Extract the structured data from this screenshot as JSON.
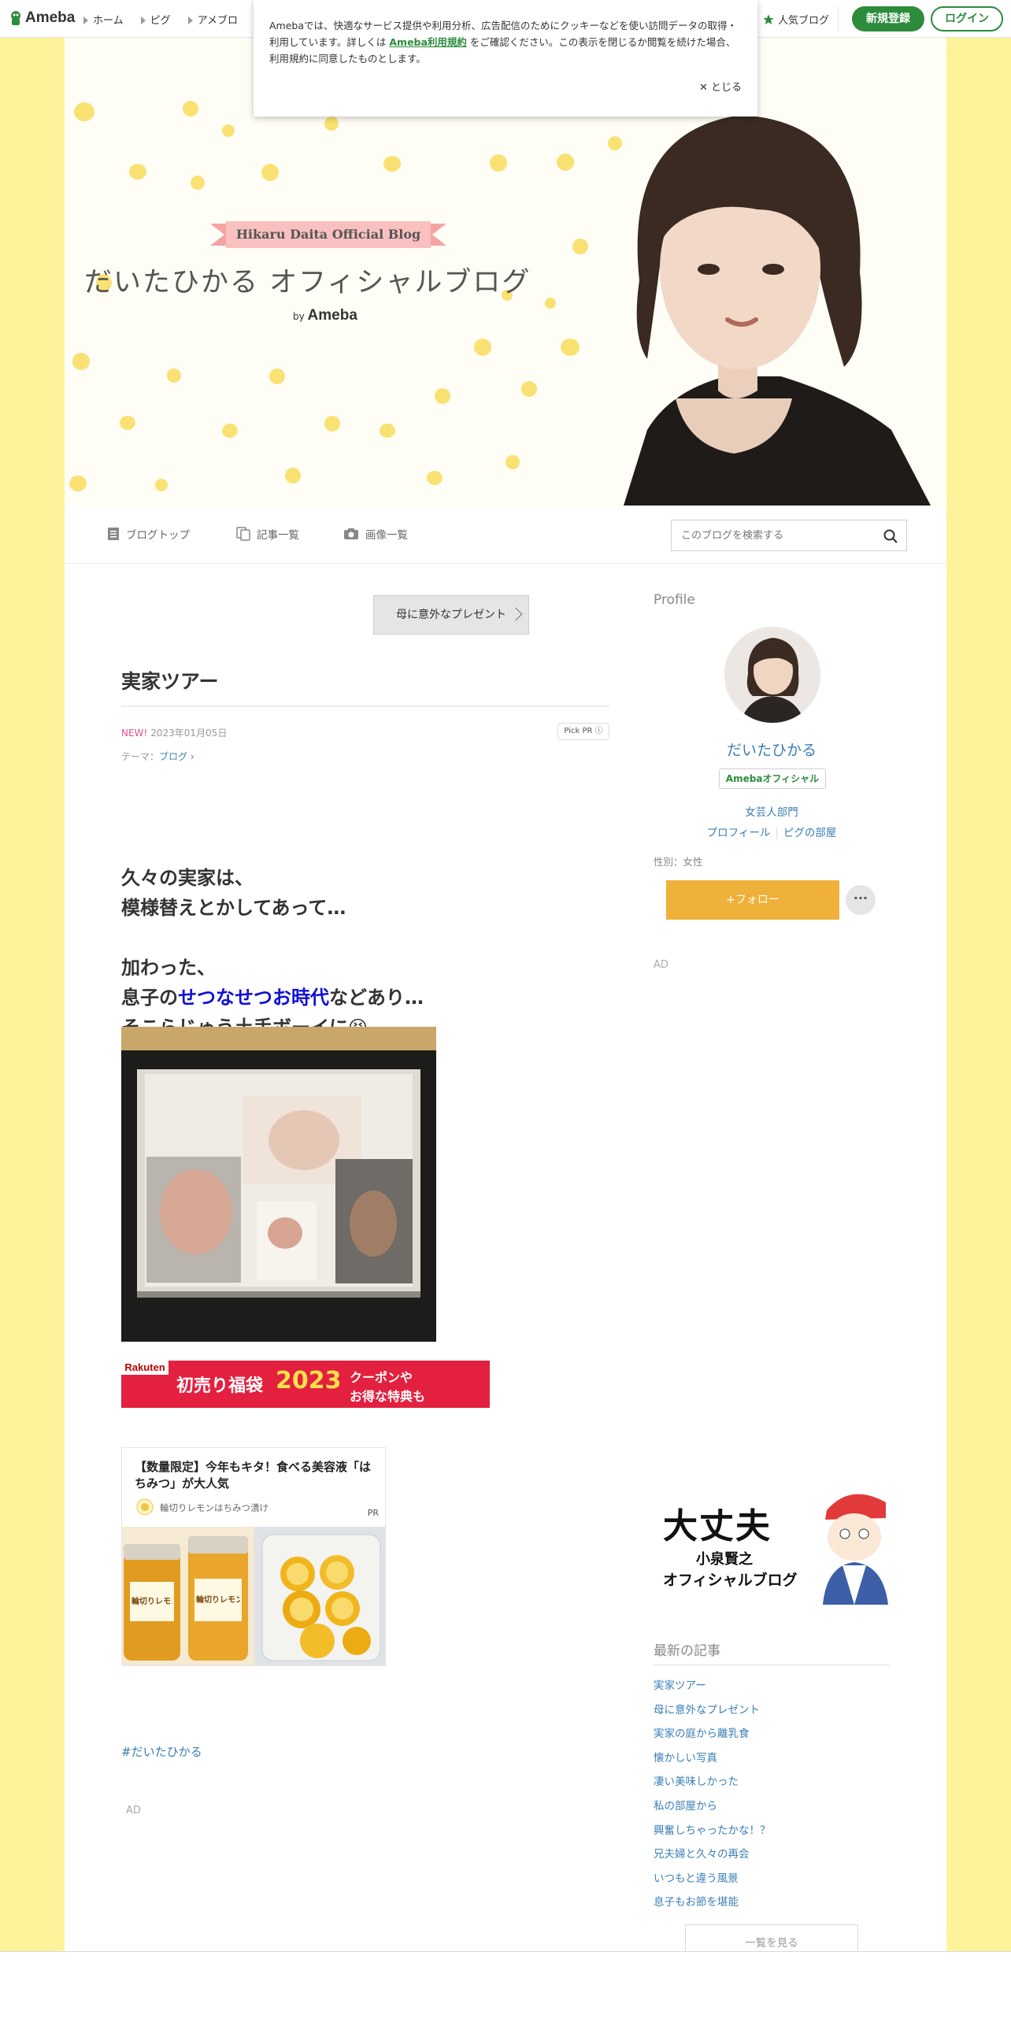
{
  "header": {
    "brand": "Ameba",
    "nav": [
      "ホーム",
      "ピグ",
      "アメブロ"
    ],
    "popular": "人気ブログ",
    "register": "新規登録",
    "login": "ログイン"
  },
  "cookie": {
    "text_before": "Amebaでは、快適なサービス提供や利用分析、広告配信のためにクッキーなどを使い訪問データの取得・利用しています。詳しくは",
    "terms_link": "Ameba利用規約",
    "text_after": "をご確認ください。この表示を閉じるか閲覧を続けた場合、利用規約に同意したものとします。",
    "close": "とじる"
  },
  "hero": {
    "subtitle": "Hikaru Daita Official Blog",
    "title": "だいたひかる オフィシャルブログ",
    "by": "by",
    "brand": "Ameba"
  },
  "blognav": {
    "top": "ブログトップ",
    "list": "記事一覧",
    "images": "画像一覧",
    "search_placeholder": "このブログを検索する"
  },
  "entry": {
    "prev_link": "母に意外なプレゼント",
    "title": "実家ツアー",
    "new_label": "NEW!",
    "date": "2023年01月05日",
    "pick": "Pick PR ⓘ",
    "theme_label": "テーマ：",
    "theme": "ブログ",
    "para1_line1": "久々の実家は、",
    "para1_line2": "模様替えとかしてあって…",
    "para2_line1": "加わった、",
    "para2_line2_pre": "息子の",
    "para2_line2_link": "せつなせつお時代",
    "para2_line2_post": "などあり…",
    "para2_line3": "そこらじゅう土手ボーイに😆",
    "rakuten_logo": "Rakuten",
    "rakuten_text1": "初売り福袋",
    "rakuten_year": "2023",
    "rakuten_text2a": "クーポンや",
    "rakuten_text2b": "お得な特典も",
    "ad_title": "【数量限定】今年もキタ！食べる美容液「はちみつ」が大人気",
    "ad_source": "輪切りレモンはちみつ漬け",
    "ad_pr": "PR",
    "jar_label": "輪切りレモン",
    "hashtag": "#だいたひかる",
    "ad_label": "AD"
  },
  "sidebar": {
    "profile_label": "Profile",
    "name": "だいたひかる",
    "badge": "Amebaオフィシャル",
    "category": "女芸人部門",
    "link_profile": "プロフィール",
    "link_pig": "ピグの部屋",
    "gender": "性別：女性",
    "follow": "+フォロー",
    "more": "···",
    "ad_label": "AD",
    "banner_line1": "大丈夫",
    "banner_line2": "小泉賢之",
    "banner_line3": "オフィシャルブログ",
    "latest_title": "最新の記事",
    "latest": [
      "実家ツアー",
      "母に意外なプレゼント",
      "実家の庭から離乳食",
      "懐かしい写真",
      "凄い美味しかった",
      "私の部屋から",
      "興奮しちゃったかな！？",
      "兄夫婦と久々の再会",
      "いつもと違う風景",
      "息子もお節を堪能"
    ],
    "list_all": "一覧を見る"
  }
}
